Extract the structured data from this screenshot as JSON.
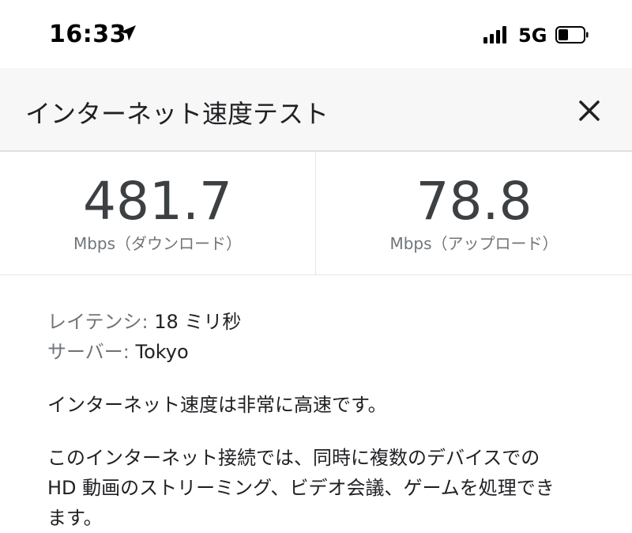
{
  "status_bar": {
    "time": "16:33",
    "network": "5G",
    "icons": [
      "location-arrow-icon",
      "signal-bars-icon",
      "battery-icon"
    ]
  },
  "header": {
    "title": "インターネット速度テスト",
    "close_icon": "close-icon"
  },
  "results": {
    "download": {
      "value": "481.7",
      "unit": "Mbps（ダウンロード）"
    },
    "upload": {
      "value": "78.8",
      "unit": "Mbps（アップロード）"
    }
  },
  "details": {
    "latency_label": "レイテンシ:",
    "latency_value": "18 ミリ秒",
    "server_label": "サーバー:",
    "server_value": "Tokyo"
  },
  "summary": "インターネット速度は非常に高速です。",
  "description": {
    "line1": "このインターネット接続では、同時に複数のデバイスでの",
    "line2": "HD 動画のストリーミング、ビデオ会議、ゲームを処理でき",
    "line3": "ます。"
  },
  "colors": {
    "header_bg": "#f7f7f8",
    "value_text": "#3c4043",
    "muted_text": "#70757a"
  }
}
